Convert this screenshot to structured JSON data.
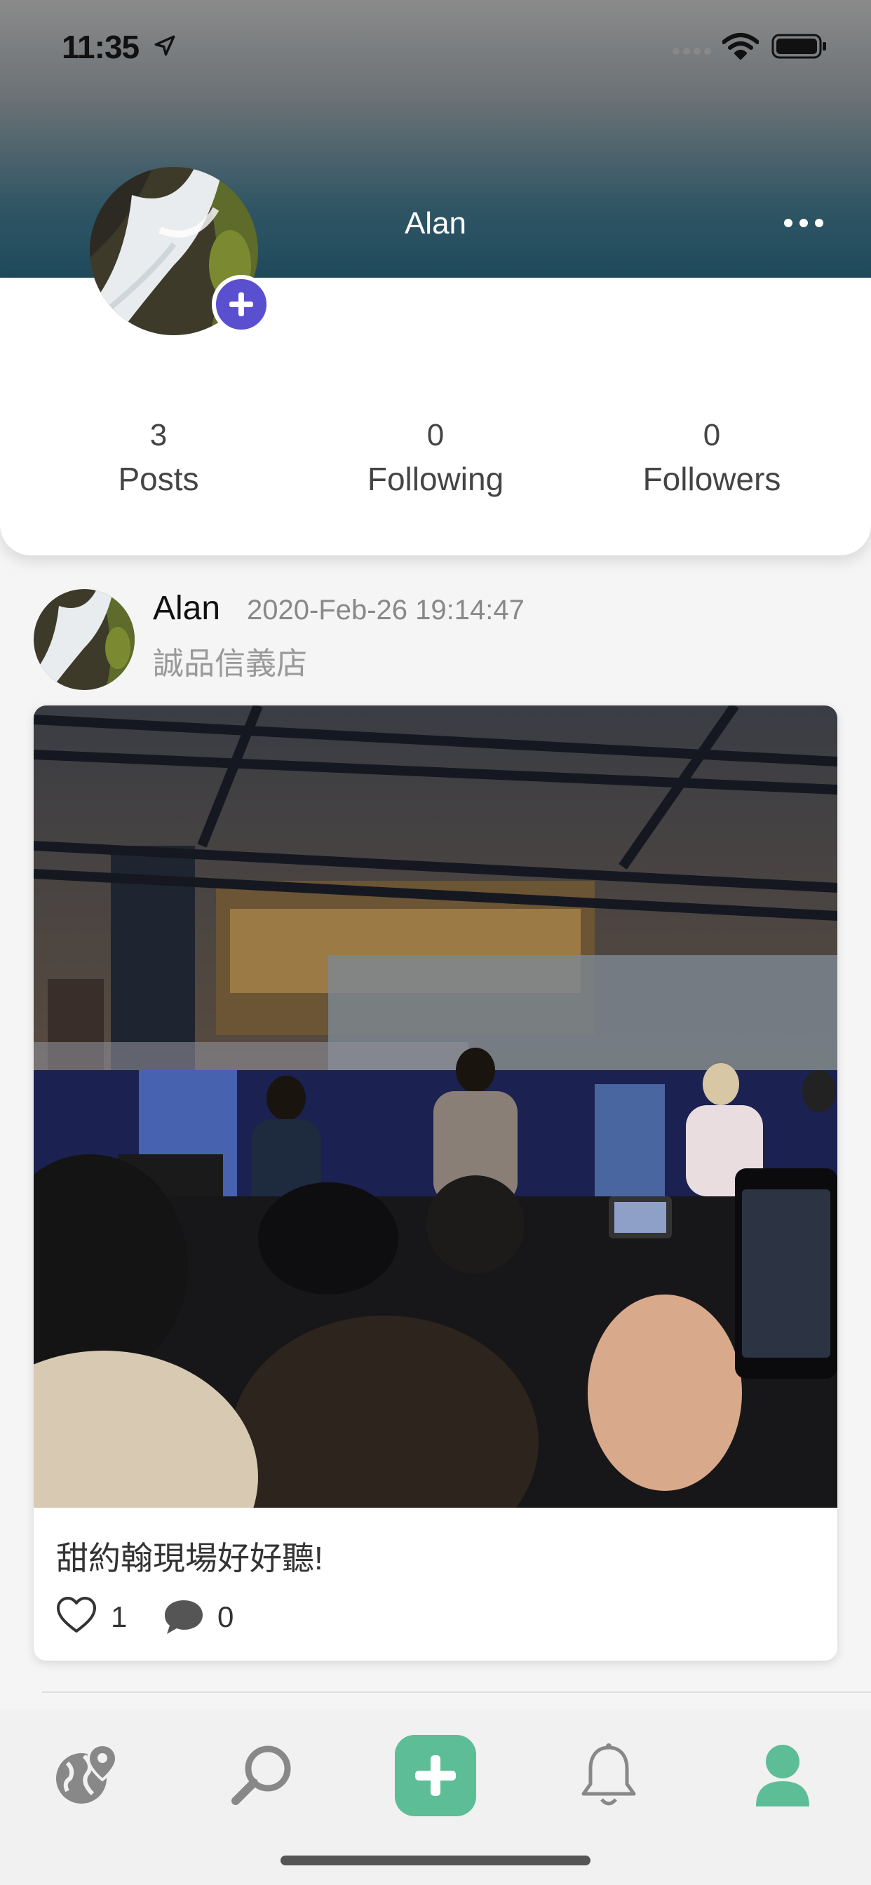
{
  "status_bar": {
    "time": "11:35"
  },
  "profile": {
    "name": "Alan",
    "stats": [
      {
        "value": "3",
        "label": "Posts"
      },
      {
        "value": "0",
        "label": "Following"
      },
      {
        "value": "0",
        "label": "Followers"
      }
    ]
  },
  "post": {
    "author": "Alan",
    "timestamp": "2020-Feb-26 19:14:47",
    "location": "誠品信義店",
    "caption": "甜約翰現場好好聽!",
    "likes": "1",
    "comments": "0"
  },
  "tabbar": {
    "items": [
      {
        "icon": "globe-pin-icon"
      },
      {
        "icon": "search-icon"
      },
      {
        "icon": "add-post-icon"
      },
      {
        "icon": "bell-icon"
      },
      {
        "icon": "profile-icon"
      }
    ],
    "accent": "#5dbd97"
  },
  "colors": {
    "avatar_add_button": "#5a4fcf"
  }
}
